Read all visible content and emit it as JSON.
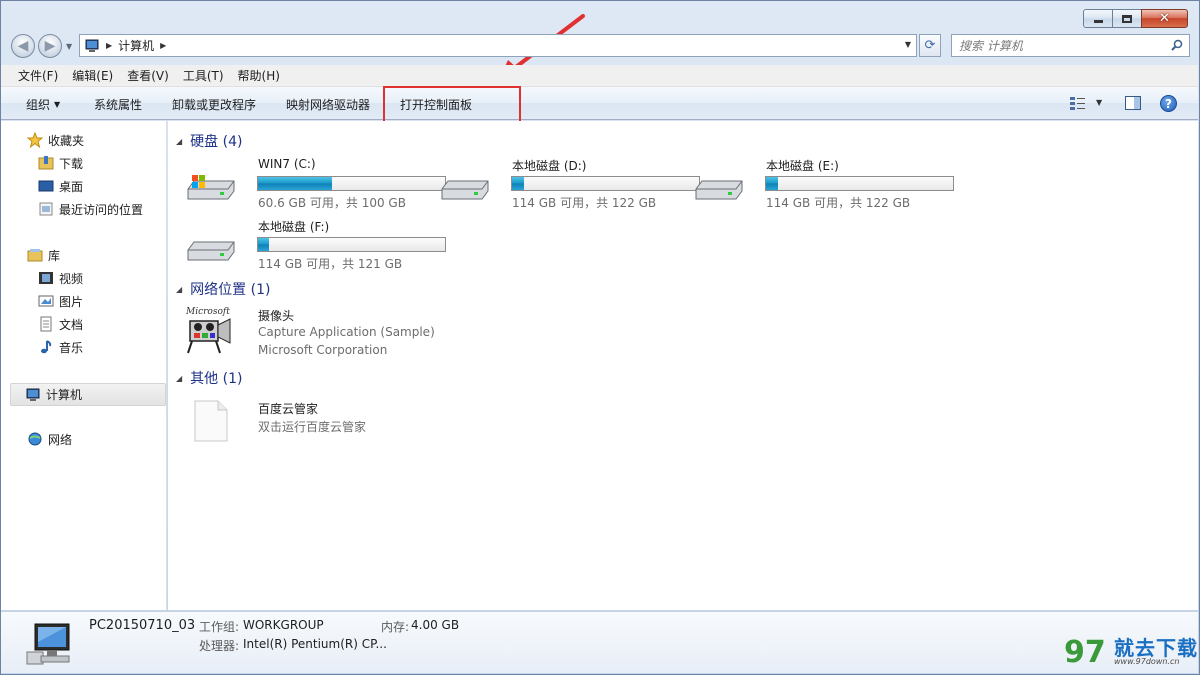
{
  "window": {
    "caption_buttons": [
      "minimize",
      "maximize",
      "close"
    ]
  },
  "address": {
    "path": "计算机",
    "search_placeholder": "搜索 计算机"
  },
  "menubar": {
    "items": [
      "文件(F)",
      "编辑(E)",
      "查看(V)",
      "工具(T)",
      "帮助(H)"
    ]
  },
  "commandbar": {
    "organize": "组织",
    "system_properties": "系统属性",
    "uninstall": "卸载或更改程序",
    "map_drive": "映射网络驱动器",
    "open_control_panel": "打开控制面板"
  },
  "navpane": {
    "favorites": "收藏夹",
    "downloads": "下载",
    "desktop": "桌面",
    "recent": "最近访问的位置",
    "libraries": "库",
    "videos": "视频",
    "pictures": "图片",
    "documents": "文档",
    "music": "音乐",
    "computer": "计算机",
    "network": "网络"
  },
  "groups": {
    "hard_disks": "硬盘 (4)",
    "network_locations": "网络位置 (1)",
    "other": "其他 (1)"
  },
  "drives": [
    {
      "name": "WIN7 (C:)",
      "free_text": "60.6 GB 可用，共 100 GB",
      "used_fraction": 0.394
    },
    {
      "name": "本地磁盘 (D:)",
      "free_text": "114 GB 可用，共 122 GB",
      "used_fraction": 0.066
    },
    {
      "name": "本地磁盘 (E:)",
      "free_text": "114 GB 可用，共 122 GB",
      "used_fraction": 0.066
    },
    {
      "name": "本地磁盘 (F:)",
      "free_text": "114 GB 可用，共 121 GB",
      "used_fraction": 0.058
    }
  ],
  "network_item": {
    "name": "摄像头",
    "line2": "Capture Application (Sample)",
    "line3": "Microsoft Corporation",
    "icon_label": "Microsoft"
  },
  "other_item": {
    "name": "百度云管家",
    "line2": "双击运行百度云管家"
  },
  "details": {
    "computer_name": "PC20150710_03",
    "workgroup_label": "工作组:",
    "workgroup_value": "WORKGROUP",
    "memory_label": "内存:",
    "memory_value": "4.00 GB",
    "processor_label": "处理器:",
    "processor_value": "Intel(R) Pentium(R) CP..."
  },
  "watermark": {
    "text": "就去下载",
    "url": "www.97down.cn",
    "logo_glyph": "97"
  },
  "colors": {
    "highlight": "#e03030",
    "group_header": "#1e3287",
    "drive_fill": "#1796c9"
  }
}
